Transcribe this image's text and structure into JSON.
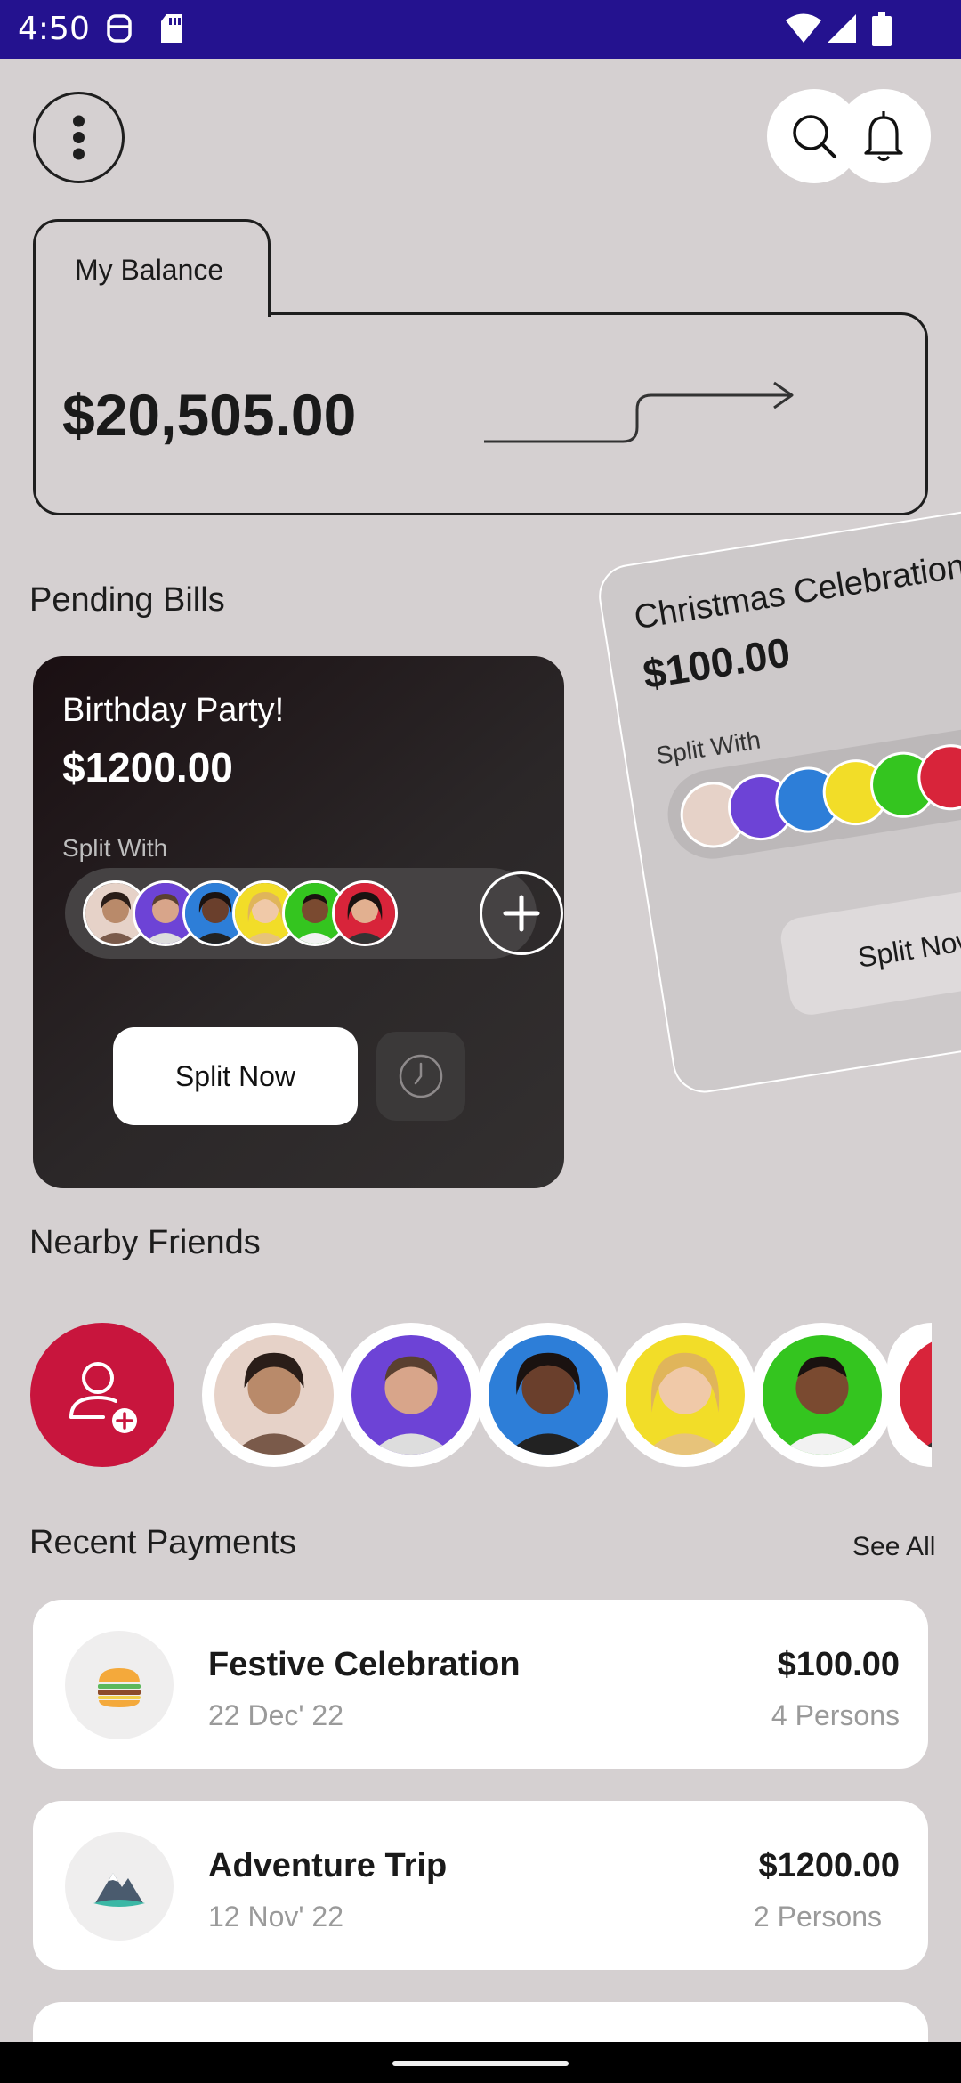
{
  "status_bar": {
    "time": "4:50",
    "left_icons": [
      "sim-toolkit-icon",
      "sd-card-icon"
    ],
    "right_icons": [
      "wifi-icon",
      "signal-icon",
      "battery-icon"
    ]
  },
  "header": {
    "menu_icon": "more-vert-icon",
    "search_icon": "search-icon",
    "notification_icon": "bell-icon"
  },
  "balance": {
    "tab_label": "My Balance",
    "amount": "$20,505.00",
    "arrow_icon": "arrow-right-icon"
  },
  "pending_bills": {
    "section_title": "Pending Bills",
    "cards": [
      {
        "title": "Birthday Party!",
        "amount": "$1200.00",
        "split_label": "Split With",
        "button_label": "Split Now",
        "plus_icon": "plus-icon",
        "clock_icon": "clock-icon",
        "background": "#1f1719"
      },
      {
        "title": "Christmas Celebration",
        "amount": "$100.00",
        "split_label": "Split With",
        "button_label": "Split Now"
      }
    ]
  },
  "friend_colors": [
    "#e6d2c8",
    "#6d43d6",
    "#2d7ed8",
    "#f2dd28",
    "#34c51f",
    "#d8243a"
  ],
  "nearby_friends": {
    "section_title": "Nearby Friends",
    "add_icon": "add-person-icon",
    "accent": "#c8153d"
  },
  "recent_payments": {
    "section_title": "Recent Payments",
    "see_all": "See All",
    "items": [
      {
        "name": "Festive Celebration",
        "date": "22 Dec' 22",
        "amount": "$100.00",
        "persons": "4 Persons",
        "icon": "burger-icon"
      },
      {
        "name": "Adventure Trip",
        "date": "12 Nov' 22",
        "amount": "$1200.00",
        "persons": "2 Persons",
        "icon": "mountain-icon"
      }
    ]
  },
  "colors": {
    "status_bar": "#24128f",
    "background": "#d5d0d1"
  }
}
